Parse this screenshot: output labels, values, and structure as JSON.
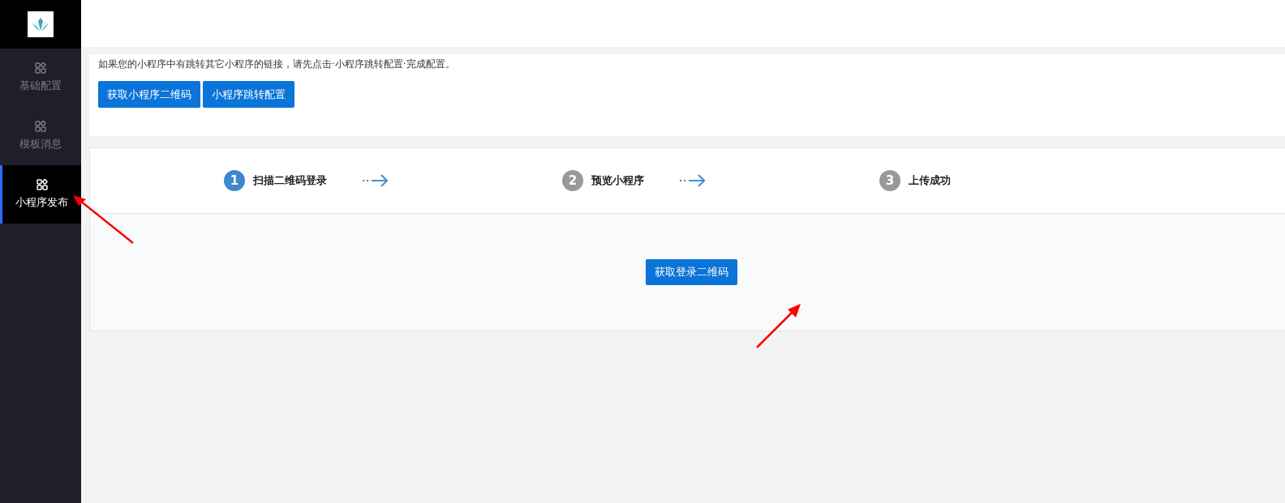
{
  "sidebar": {
    "items": [
      {
        "label": "基础配置",
        "selected": false
      },
      {
        "label": "模板消息",
        "selected": false
      },
      {
        "label": "小程序发布",
        "selected": true
      }
    ]
  },
  "notice": {
    "text": "如果您的小程序中有跳转其它小程序的链接，请先点击·小程序跳转配置·完成配置。",
    "buttons": [
      "获取小程序二维码",
      "小程序跳转配置"
    ]
  },
  "steps": [
    {
      "number": "1",
      "label": "扫描二维码登录",
      "selected": true
    },
    {
      "number": "2",
      "label": "预览小程序",
      "selected": false
    },
    {
      "number": "3",
      "label": "上传成功",
      "selected": false
    }
  ],
  "main_button": "获取登录二维码"
}
